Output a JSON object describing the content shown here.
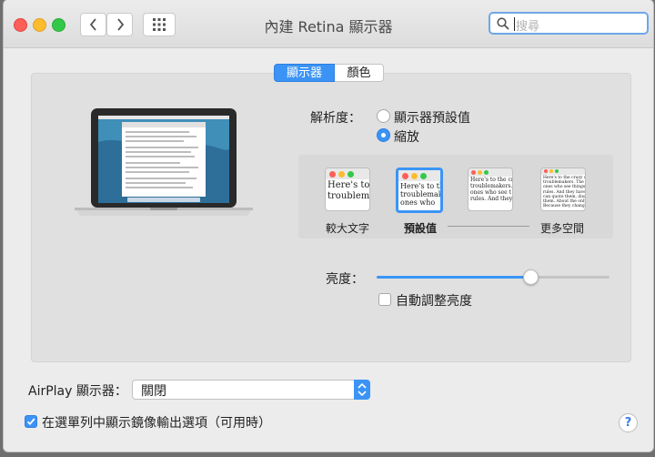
{
  "window": {
    "title": "內建 Retina 顯示器"
  },
  "search": {
    "placeholder": "搜尋"
  },
  "tabs": [
    {
      "label": "顯示器",
      "selected": true
    },
    {
      "label": "顏色",
      "selected": false
    }
  ],
  "resolution": {
    "label": "解析度：",
    "options": [
      {
        "label": "顯示器預設值",
        "selected": false
      },
      {
        "label": "縮放",
        "selected": true
      }
    ]
  },
  "scaling": {
    "thumbnails": [
      {
        "text": "Here's to\ntroublem",
        "size": "large",
        "caption": "較大文字"
      },
      {
        "text": "Here's to the\ntroublemak\nones who",
        "size": "medium",
        "caption": "預設值",
        "selected": true
      },
      {
        "text": "Here's to the cr\ntroublemakers.\nones who see t\nrules. And they",
        "size": "small",
        "caption": ""
      },
      {
        "text": "Here's to the crazy one\ntroublemakers. The rou\nones who see things di\nrules. And they have no\ncan quote them, disagre\nthem. About the only th\nBecause they change th",
        "size": "tiny",
        "caption": "更多空間"
      }
    ]
  },
  "brightness": {
    "label": "亮度：",
    "value": 0.66,
    "auto_label": "自動調整亮度",
    "auto_checked": false
  },
  "airplay": {
    "label": "AirPlay 顯示器：",
    "value": "關閉"
  },
  "mirroring": {
    "label": "在選單列中顯示鏡像輸出選項（可用時）",
    "checked": true
  },
  "colors": {
    "accent": "#3b94f5",
    "close": "#fc5f57",
    "minimize": "#fdbc2e",
    "zoom": "#34c84a"
  },
  "icons": {
    "back": "chevron-left-icon",
    "forward": "chevron-right-icon",
    "grid": "grid-icon",
    "search": "search-icon",
    "help": "help-icon",
    "laptop": "laptop-icon"
  }
}
